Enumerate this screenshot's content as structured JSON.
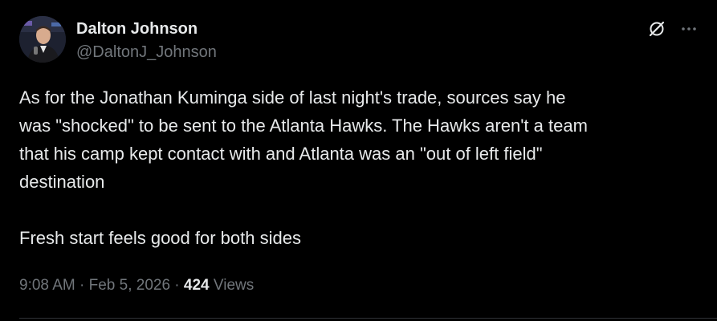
{
  "author": {
    "display_name": "Dalton Johnson",
    "handle": "@DaltonJ_Johnson",
    "avatar_icon": "person-photo-avatar"
  },
  "actions": {
    "grok_icon": "grok-slash-circle-icon",
    "more_icon": "more-dots-icon"
  },
  "tweet": {
    "paragraph_1": "As for the Jonathan Kuminga side of last night's trade, sources say he\nwas \"shocked\" to be sent to the Atlanta Hawks. The Hawks aren't a team\nthat his camp kept contact with and Atlanta was an \"out of left field\"\ndestination",
    "paragraph_2": "Fresh start feels good for both sides"
  },
  "meta": {
    "time": "9:08 AM",
    "separator_1": " · ",
    "date": "Feb 5, 2026",
    "separator_2": " · ",
    "views_count": "424",
    "views_label": " Views"
  },
  "colors": {
    "background": "#000000",
    "primary_text": "#e7e9ea",
    "secondary_text": "#71767b",
    "divider": "#2f3336"
  }
}
